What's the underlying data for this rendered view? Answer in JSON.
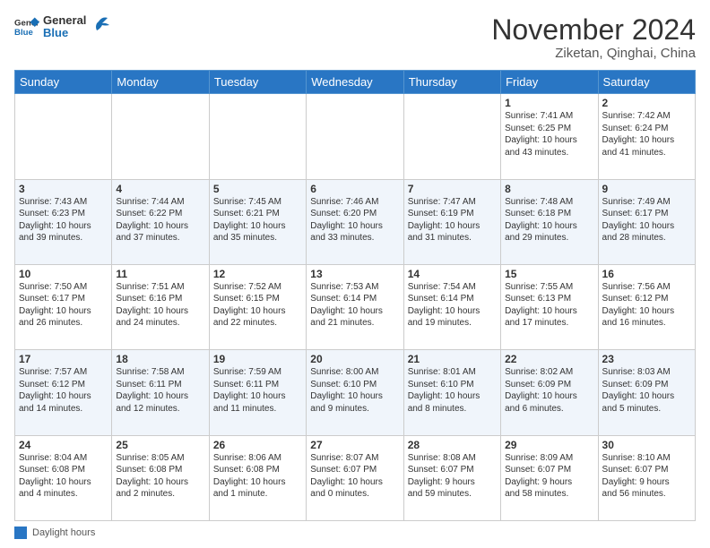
{
  "header": {
    "logo_general": "General",
    "logo_blue": "Blue",
    "month_title": "November 2024",
    "subtitle": "Ziketan, Qinghai, China"
  },
  "days_of_week": [
    "Sunday",
    "Monday",
    "Tuesday",
    "Wednesday",
    "Thursday",
    "Friday",
    "Saturday"
  ],
  "legend": {
    "label": "Daylight hours"
  },
  "weeks": [
    [
      {
        "day": "",
        "info": ""
      },
      {
        "day": "",
        "info": ""
      },
      {
        "day": "",
        "info": ""
      },
      {
        "day": "",
        "info": ""
      },
      {
        "day": "",
        "info": ""
      },
      {
        "day": "1",
        "info": "Sunrise: 7:41 AM\nSunset: 6:25 PM\nDaylight: 10 hours\nand 43 minutes."
      },
      {
        "day": "2",
        "info": "Sunrise: 7:42 AM\nSunset: 6:24 PM\nDaylight: 10 hours\nand 41 minutes."
      }
    ],
    [
      {
        "day": "3",
        "info": "Sunrise: 7:43 AM\nSunset: 6:23 PM\nDaylight: 10 hours\nand 39 minutes."
      },
      {
        "day": "4",
        "info": "Sunrise: 7:44 AM\nSunset: 6:22 PM\nDaylight: 10 hours\nand 37 minutes."
      },
      {
        "day": "5",
        "info": "Sunrise: 7:45 AM\nSunset: 6:21 PM\nDaylight: 10 hours\nand 35 minutes."
      },
      {
        "day": "6",
        "info": "Sunrise: 7:46 AM\nSunset: 6:20 PM\nDaylight: 10 hours\nand 33 minutes."
      },
      {
        "day": "7",
        "info": "Sunrise: 7:47 AM\nSunset: 6:19 PM\nDaylight: 10 hours\nand 31 minutes."
      },
      {
        "day": "8",
        "info": "Sunrise: 7:48 AM\nSunset: 6:18 PM\nDaylight: 10 hours\nand 29 minutes."
      },
      {
        "day": "9",
        "info": "Sunrise: 7:49 AM\nSunset: 6:17 PM\nDaylight: 10 hours\nand 28 minutes."
      }
    ],
    [
      {
        "day": "10",
        "info": "Sunrise: 7:50 AM\nSunset: 6:17 PM\nDaylight: 10 hours\nand 26 minutes."
      },
      {
        "day": "11",
        "info": "Sunrise: 7:51 AM\nSunset: 6:16 PM\nDaylight: 10 hours\nand 24 minutes."
      },
      {
        "day": "12",
        "info": "Sunrise: 7:52 AM\nSunset: 6:15 PM\nDaylight: 10 hours\nand 22 minutes."
      },
      {
        "day": "13",
        "info": "Sunrise: 7:53 AM\nSunset: 6:14 PM\nDaylight: 10 hours\nand 21 minutes."
      },
      {
        "day": "14",
        "info": "Sunrise: 7:54 AM\nSunset: 6:14 PM\nDaylight: 10 hours\nand 19 minutes."
      },
      {
        "day": "15",
        "info": "Sunrise: 7:55 AM\nSunset: 6:13 PM\nDaylight: 10 hours\nand 17 minutes."
      },
      {
        "day": "16",
        "info": "Sunrise: 7:56 AM\nSunset: 6:12 PM\nDaylight: 10 hours\nand 16 minutes."
      }
    ],
    [
      {
        "day": "17",
        "info": "Sunrise: 7:57 AM\nSunset: 6:12 PM\nDaylight: 10 hours\nand 14 minutes."
      },
      {
        "day": "18",
        "info": "Sunrise: 7:58 AM\nSunset: 6:11 PM\nDaylight: 10 hours\nand 12 minutes."
      },
      {
        "day": "19",
        "info": "Sunrise: 7:59 AM\nSunset: 6:11 PM\nDaylight: 10 hours\nand 11 minutes."
      },
      {
        "day": "20",
        "info": "Sunrise: 8:00 AM\nSunset: 6:10 PM\nDaylight: 10 hours\nand 9 minutes."
      },
      {
        "day": "21",
        "info": "Sunrise: 8:01 AM\nSunset: 6:10 PM\nDaylight: 10 hours\nand 8 minutes."
      },
      {
        "day": "22",
        "info": "Sunrise: 8:02 AM\nSunset: 6:09 PM\nDaylight: 10 hours\nand 6 minutes."
      },
      {
        "day": "23",
        "info": "Sunrise: 8:03 AM\nSunset: 6:09 PM\nDaylight: 10 hours\nand 5 minutes."
      }
    ],
    [
      {
        "day": "24",
        "info": "Sunrise: 8:04 AM\nSunset: 6:08 PM\nDaylight: 10 hours\nand 4 minutes."
      },
      {
        "day": "25",
        "info": "Sunrise: 8:05 AM\nSunset: 6:08 PM\nDaylight: 10 hours\nand 2 minutes."
      },
      {
        "day": "26",
        "info": "Sunrise: 8:06 AM\nSunset: 6:08 PM\nDaylight: 10 hours\nand 1 minute."
      },
      {
        "day": "27",
        "info": "Sunrise: 8:07 AM\nSunset: 6:07 PM\nDaylight: 10 hours\nand 0 minutes."
      },
      {
        "day": "28",
        "info": "Sunrise: 8:08 AM\nSunset: 6:07 PM\nDaylight: 9 hours\nand 59 minutes."
      },
      {
        "day": "29",
        "info": "Sunrise: 8:09 AM\nSunset: 6:07 PM\nDaylight: 9 hours\nand 58 minutes."
      },
      {
        "day": "30",
        "info": "Sunrise: 8:10 AM\nSunset: 6:07 PM\nDaylight: 9 hours\nand 56 minutes."
      }
    ]
  ]
}
